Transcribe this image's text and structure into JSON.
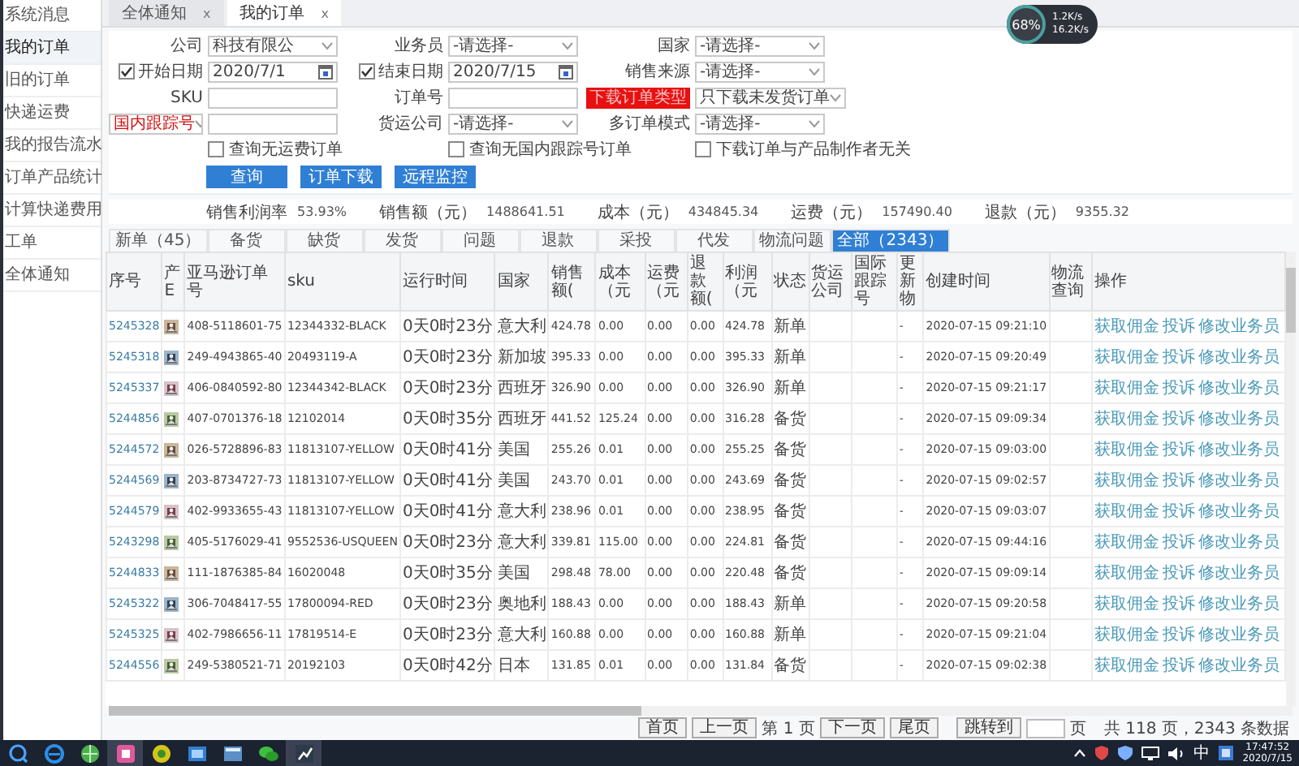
{
  "sidebar": {
    "items": [
      {
        "label": "系统消息",
        "selected": false
      },
      {
        "label": "我的订单",
        "selected": true
      },
      {
        "label": "旧的订单",
        "selected": false
      },
      {
        "label": "快递运费",
        "selected": false
      },
      {
        "label": "我的报告流水",
        "selected": false
      },
      {
        "label": "订单产品统计",
        "selected": false
      },
      {
        "label": "计算快递费用",
        "selected": false
      },
      {
        "label": "工单",
        "selected": false
      },
      {
        "label": "全体通知",
        "selected": false
      }
    ]
  },
  "tabs": [
    {
      "label": "全体通知",
      "close": "x",
      "selected": false
    },
    {
      "label": "我的订单",
      "close": "x",
      "selected": true
    }
  ],
  "filters": {
    "rows": [
      [
        {
          "kind": "select",
          "label": "公司",
          "value": "科技有限公"
        },
        {
          "kind": "select",
          "label": "业务员",
          "value": "-请选择-"
        },
        {
          "kind": "select",
          "label": "国家",
          "value": "-请选择-"
        }
      ],
      [
        {
          "kind": "date",
          "label": "开始日期",
          "checked": true,
          "value": "2020/7/1"
        },
        {
          "kind": "date",
          "label": "结束日期",
          "checked": true,
          "value": "2020/7/15"
        },
        {
          "kind": "select",
          "label": "销售来源",
          "value": "-请选择-"
        }
      ],
      [
        {
          "kind": "text",
          "label": "SKU"
        },
        {
          "kind": "text",
          "label": "订单号"
        },
        {
          "kind": "alert-select",
          "label": "下载订单类型",
          "value": "只下载未发货订单"
        }
      ],
      [
        {
          "kind": "picker-text",
          "label": "国内跟踪号"
        },
        {
          "kind": "select",
          "label": "货运公司",
          "value": "-请选择-"
        },
        {
          "kind": "select",
          "label": "多订单模式",
          "value": "-请选择-"
        }
      ]
    ],
    "checkboxes": [
      {
        "label": "查询无运费订单",
        "checked": false
      },
      {
        "label": "查询无国内跟踪号订单",
        "checked": false
      },
      {
        "label": "下载订单与产品制作者无关",
        "checked": false
      }
    ],
    "buttons": [
      "查询",
      "订单下载",
      "远程监控"
    ]
  },
  "stats": [
    {
      "label": "销售利润率",
      "value": "53.93%"
    },
    {
      "label": "销售额（元）",
      "value": "1488641.51"
    },
    {
      "label": "成本（元）",
      "value": "434845.34"
    },
    {
      "label": "运费（元）",
      "value": "157490.40"
    },
    {
      "label": "退款（元）",
      "value": "9355.32"
    }
  ],
  "status_tabs": [
    {
      "label": "新单（45）",
      "selected": false
    },
    {
      "label": "备货",
      "selected": false
    },
    {
      "label": "缺货",
      "selected": false
    },
    {
      "label": "发货",
      "selected": false
    },
    {
      "label": "问题",
      "selected": false
    },
    {
      "label": "退款",
      "selected": false
    },
    {
      "label": "采投",
      "selected": false
    },
    {
      "label": "代发",
      "selected": false
    },
    {
      "label": "物流问题",
      "selected": false
    },
    {
      "label": "全部（2343）",
      "selected": true
    }
  ],
  "table": {
    "columns": [
      "序号",
      "产E",
      "亚马逊订单号",
      "sku",
      "运行时间",
      "国家",
      "销售额(",
      "成本（元",
      "运费（元",
      "退款额(",
      "利润（元",
      "状态",
      "货运公司",
      "国际跟踪号",
      "更新物",
      "创建时间",
      "物流查询",
      "操作"
    ],
    "rows": [
      {
        "id": "5245328",
        "order_no": "408-5118601-75",
        "sku": "12344332-BLACK",
        "run_time": "0天0时23分",
        "country": "意大利",
        "sales": "424.78",
        "cost": "0.00",
        "shipping": "0.00",
        "refund": "0.00",
        "profit": "424.78",
        "status": "新单",
        "update": "-",
        "created": "2020-07-15 09:21:10",
        "actions": [
          "获取佣金",
          "投诉",
          "修改业务员"
        ]
      },
      {
        "id": "5245318",
        "order_no": "249-4943865-40",
        "sku": "20493119-A",
        "run_time": "0天0时23分",
        "country": "新加坡",
        "sales": "395.33",
        "cost": "0.00",
        "shipping": "0.00",
        "refund": "0.00",
        "profit": "395.33",
        "status": "新单",
        "update": "-",
        "created": "2020-07-15 09:20:49",
        "actions": [
          "获取佣金",
          "投诉",
          "修改业务员"
        ]
      },
      {
        "id": "5245337",
        "order_no": "406-0840592-80",
        "sku": "12344342-BLACK",
        "run_time": "0天0时23分",
        "country": "西班牙",
        "sales": "326.90",
        "cost": "0.00",
        "shipping": "0.00",
        "refund": "0.00",
        "profit": "326.90",
        "status": "新单",
        "update": "-",
        "created": "2020-07-15 09:21:17",
        "actions": [
          "获取佣金",
          "投诉",
          "修改业务员"
        ]
      },
      {
        "id": "5244856",
        "order_no": "407-0701376-18",
        "sku": "12102014",
        "run_time": "0天0时35分",
        "country": "西班牙",
        "sales": "441.52",
        "cost": "125.24",
        "shipping": "0.00",
        "refund": "0.00",
        "profit": "316.28",
        "status": "备货",
        "update": "-",
        "created": "2020-07-15 09:09:34",
        "actions": [
          "获取佣金",
          "投诉",
          "修改业务员"
        ]
      },
      {
        "id": "5244572",
        "order_no": "026-5728896-83",
        "sku": "11813107-YELLOW",
        "run_time": "0天0时41分",
        "country": "美国",
        "sales": "255.26",
        "cost": "0.01",
        "shipping": "0.00",
        "refund": "0.00",
        "profit": "255.25",
        "status": "备货",
        "update": "-",
        "created": "2020-07-15 09:03:00",
        "actions": [
          "获取佣金",
          "投诉",
          "修改业务员"
        ]
      },
      {
        "id": "5244569",
        "order_no": "203-8734727-73",
        "sku": "11813107-YELLOW",
        "run_time": "0天0时41分",
        "country": "美国",
        "sales": "243.70",
        "cost": "0.01",
        "shipping": "0.00",
        "refund": "0.00",
        "profit": "243.69",
        "status": "备货",
        "update": "-",
        "created": "2020-07-15 09:02:57",
        "actions": [
          "获取佣金",
          "投诉",
          "修改业务员"
        ]
      },
      {
        "id": "5244579",
        "order_no": "402-9933655-43",
        "sku": "11813107-YELLOW",
        "run_time": "0天0时41分",
        "country": "意大利",
        "sales": "238.96",
        "cost": "0.01",
        "shipping": "0.00",
        "refund": "0.00",
        "profit": "238.95",
        "status": "备货",
        "update": "-",
        "created": "2020-07-15 09:03:07",
        "actions": [
          "获取佣金",
          "投诉",
          "修改业务员"
        ]
      },
      {
        "id": "5243298",
        "order_no": "405-5176029-41",
        "sku": "9552536-USQUEEN",
        "run_time": "0天0时23分",
        "country": "意大利",
        "sales": "339.81",
        "cost": "115.00",
        "shipping": "0.00",
        "refund": "0.00",
        "profit": "224.81",
        "status": "备货",
        "update": "-",
        "created": "2020-07-15 09:44:16",
        "actions": [
          "获取佣金",
          "投诉",
          "修改业务员"
        ]
      },
      {
        "id": "5244833",
        "order_no": "111-1876385-84",
        "sku": "16020048",
        "run_time": "0天0时35分",
        "country": "美国",
        "sales": "298.48",
        "cost": "78.00",
        "shipping": "0.00",
        "refund": "0.00",
        "profit": "220.48",
        "status": "备货",
        "update": "-",
        "created": "2020-07-15 09:09:14",
        "actions": [
          "获取佣金",
          "投诉",
          "修改业务员"
        ]
      },
      {
        "id": "5245322",
        "order_no": "306-7048417-55",
        "sku": "17800094-RED",
        "run_time": "0天0时23分",
        "country": "奥地利",
        "sales": "188.43",
        "cost": "0.00",
        "shipping": "0.00",
        "refund": "0.00",
        "profit": "188.43",
        "status": "新单",
        "update": "-",
        "created": "2020-07-15 09:20:58",
        "actions": [
          "获取佣金",
          "投诉",
          "修改业务员"
        ]
      },
      {
        "id": "5245325",
        "order_no": "402-7986656-11",
        "sku": "17819514-E",
        "run_time": "0天0时23分",
        "country": "意大利",
        "sales": "160.88",
        "cost": "0.00",
        "shipping": "0.00",
        "refund": "0.00",
        "profit": "160.88",
        "status": "新单",
        "update": "-",
        "created": "2020-07-15 09:21:04",
        "actions": [
          "获取佣金",
          "投诉",
          "修改业务员"
        ]
      },
      {
        "id": "5244556",
        "order_no": "249-5380521-71",
        "sku": "20192103",
        "run_time": "0天0时42分",
        "country": "日本",
        "sales": "131.85",
        "cost": "0.01",
        "shipping": "0.00",
        "refund": "0.00",
        "profit": "131.84",
        "status": "备货",
        "update": "-",
        "created": "2020-07-15 09:02:38",
        "actions": [
          "获取佣金",
          "投诉",
          "修改业务员"
        ]
      }
    ]
  },
  "pagination": {
    "first": "首页",
    "prev": "上一页",
    "page_label": "第 1 页",
    "next": "下一页",
    "last": "尾页",
    "jump": "跳转到",
    "page_suffix": "页",
    "summary": "共 118 页，2343 条数据"
  },
  "net_widget": {
    "percent": "68%",
    "upload": "1.2K/s",
    "download": "16.2K/s"
  },
  "taskbar": {
    "ime": "中",
    "time": "17:47:52",
    "date": "2020/7/15"
  }
}
